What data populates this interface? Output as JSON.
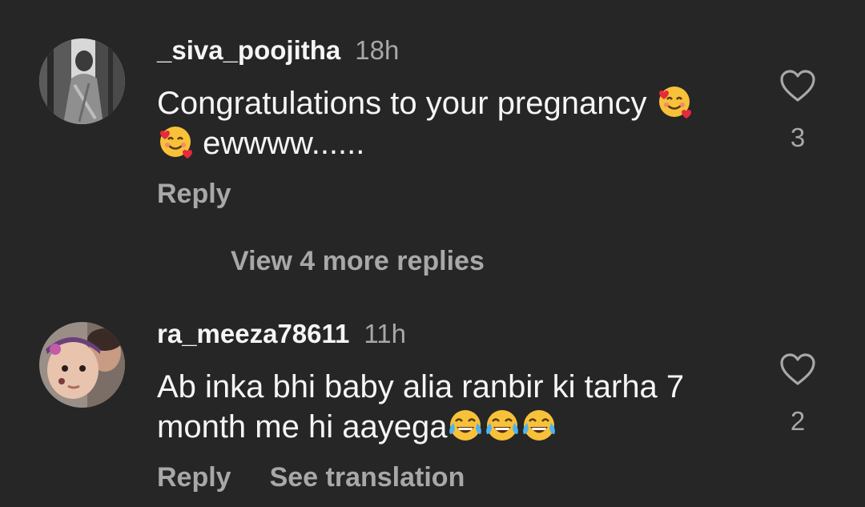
{
  "comments": [
    {
      "username": "_siva_poojitha",
      "time": "18h",
      "text_line1": "Congratulations to your pregnancy ",
      "text_line2": " ewwww......",
      "likes": "3",
      "reply_label": "Reply",
      "emoji": [
        "smiling-face-with-hearts",
        "smiling-face-with-hearts"
      ]
    },
    {
      "username": "ra_meeza78611",
      "time": "11h",
      "text_line1": "Ab inka bhi baby alia ranbir ki tarha 7",
      "text_line2": "month me hi aayega",
      "likes": "2",
      "reply_label": "Reply",
      "translate_label": "See translation",
      "emoji": [
        "face-with-tears-of-joy",
        "face-with-tears-of-joy",
        "face-with-tears-of-joy"
      ]
    }
  ],
  "view_more_label": "View 4 more replies",
  "icons": {
    "like": "heart-outline-icon"
  },
  "colors": {
    "background": "#262626",
    "primary_text": "#f5f5f5",
    "secondary_text": "#a8a8a8"
  }
}
